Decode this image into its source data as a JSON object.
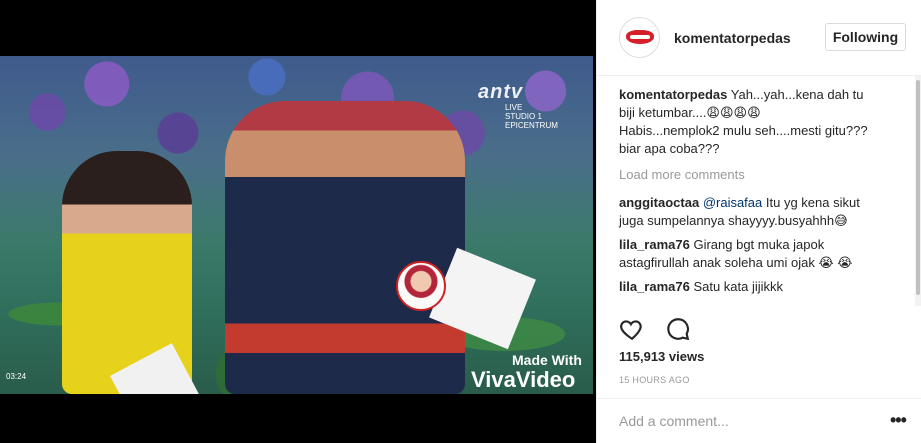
{
  "video": {
    "channel_logo": "antv",
    "channel_live": "LIVE",
    "channel_studio": "STUDIO 1",
    "channel_venue": "EPICENTRUM",
    "watermark_made_with": "Made With",
    "watermark_brand": "VivaVideo",
    "timecode": "03:24"
  },
  "post": {
    "username": "komentatorpedas",
    "follow_label": "Following",
    "caption_line1": "Yah...yah...kena dah tu",
    "caption_line2": "biji ketumbar....😩😩😩😩",
    "caption_line3": "Habis...nemplok2 mulu seh....mesti gitu???",
    "caption_line4": "biar apa coba???",
    "load_more": "Load more comments",
    "comments": [
      {
        "user": "anggitaoctaa",
        "mention": "@raisafaa",
        "text": " Itu yg kena sikut",
        "text2": "juga sumpelannya shayyyy.busyahhh😅"
      },
      {
        "user": "lila_rama76",
        "text": " Girang bgt muka japok",
        "text2": "astagfirullah anak soleha umi ojak 😭 😭"
      },
      {
        "user": "lila_rama76",
        "text": " Satu kata jijikkk"
      }
    ],
    "views": "115,913 views",
    "time": "15 HOURS AGO",
    "comment_placeholder": "Add a comment...",
    "more": "•••"
  },
  "colors": {
    "accent_follow_border": "#dbdbdb",
    "mention": "#003569",
    "muted": "#999999"
  },
  "icons": [
    "heart-icon",
    "comment-icon",
    "more-options-icon"
  ]
}
